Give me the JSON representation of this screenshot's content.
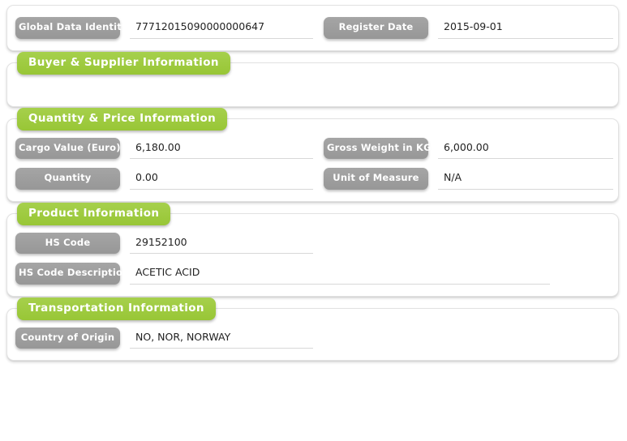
{
  "theme": {
    "accent_green": "#9fcb3f",
    "label_gray": "#9e9e9e",
    "page_background": "#ffffff",
    "value_text": "#222222"
  },
  "sections": [
    {
      "id": "identity",
      "has_tab": false,
      "title": "",
      "rows": [
        {
          "left": {
            "label": "Global Data Identity",
            "value": "77712015090000000647"
          },
          "right": {
            "label": "Register Date",
            "value": "2015-09-01"
          }
        }
      ]
    },
    {
      "id": "buyer-supplier",
      "has_tab": true,
      "title": "Buyer & Supplier Information",
      "rows": []
    },
    {
      "id": "quantity-price",
      "has_tab": true,
      "title": "Quantity & Price Information",
      "rows": [
        {
          "left": {
            "label": "Cargo Value (Euro)",
            "value": "6,180.00"
          },
          "right": {
            "label": "Gross Weight in KG",
            "value": "6,000.00"
          }
        },
        {
          "left": {
            "label": "Quantity",
            "value": "0.00"
          },
          "right": {
            "label": "Unit of Measure",
            "value": "N/A"
          }
        }
      ]
    },
    {
      "id": "product",
      "has_tab": true,
      "title": "Product Information",
      "rows": [
        {
          "left": {
            "label": "HS Code",
            "value": "29152100"
          }
        },
        {
          "wide": {
            "label": "HS Code Description",
            "value": "ACETIC ACID"
          }
        }
      ]
    },
    {
      "id": "transportation",
      "has_tab": true,
      "title": "Transportation Information",
      "rows": [
        {
          "left": {
            "label": "Country of Origin",
            "value": "NO, NOR, NORWAY"
          }
        }
      ]
    }
  ]
}
